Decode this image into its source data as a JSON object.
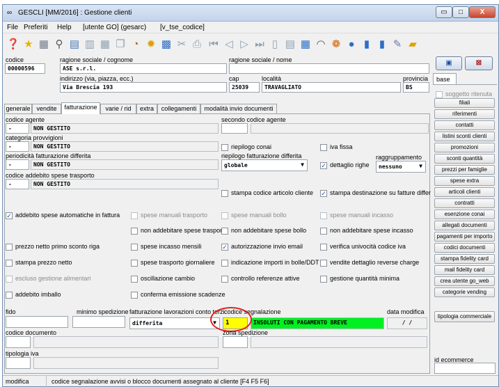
{
  "window": {
    "title": "GESCLI [MM/2016] : Gestione clienti",
    "minimize": "▭",
    "maximize": "□",
    "close": "X"
  },
  "menu": [
    "File",
    "Preferiti",
    "Help",
    "[utente GO] (gesarc)",
    "[v_tse_codice]"
  ],
  "header": {
    "codice_label": "codice",
    "codice": "00000596",
    "ragione_label": "ragione sociale / cognome",
    "ragione": "ASE s.r.l.",
    "nome_label": "ragione sociale / nome",
    "indirizzo_label": "indirizzo (via, piazza, ecc.)",
    "indirizzo": "Via Brescia 193",
    "cap_label": "cap",
    "cap": "25039",
    "localita_label": "località",
    "localita": "TRAVAGLIATO",
    "provincia_label": "provincia",
    "provincia": "BS",
    "base_tab": "base",
    "soggetto": "soggetto ritenuta"
  },
  "tabs": [
    "generale",
    "vendite",
    "fatturazione",
    "varie / rid",
    "extra",
    "collegamenti",
    "modalità invio documenti"
  ],
  "form": {
    "codice_agente_label": "codice agente",
    "codice_agente_code": "-",
    "codice_agente_value": "NON GESTITO",
    "secondo_agente_label": "secondo codice agente",
    "cat_prov_label": "categoria provvigioni",
    "cat_prov_code": "-",
    "cat_prov_value": "NON GESTITO",
    "riepilogo_conai": "riepilogo conai",
    "iva_fissa": "iva fissa",
    "period_label": "periodicità fatturazione differita",
    "period_code": "-",
    "period_value": "NON GESTITO",
    "riepilogo_fatt_label": "riepilogo fatturazione differita",
    "riepilogo_fatt_value": "globale",
    "dettaglio_righe": "dettaglio righe",
    "raggr_label": "raggruppamento",
    "raggr_value": "nessuno",
    "addebito_label": "codice addebito spese trasporto",
    "addebito_code": "-",
    "addebito_value": "NON GESTITO",
    "stampa_codice": "stampa codice articolo cliente",
    "stampa_dest": "stampa destinazione su fatture differ",
    "addebito_auto": "addebito spese automatiche in fattura",
    "spese_man_trasp": "spese manuali trasporto",
    "spese_man_bollo": "spese manuali bollo",
    "spese_man_incasso": "spese manuali incasso",
    "non_add_trasp": "non addebitare spese trasporto",
    "non_add_bollo": "non addebitare spese bollo",
    "non_add_incasso": "non addebitare spese incasso",
    "prezzo_netto_primo": "prezzo netto primo sconto riga",
    "spese_incasso_mens": "spese incasso mensili",
    "autorizz_email": "autorizzazione invio email",
    "verifica_iva": "verifica univocità codice iva",
    "stampa_prezzo": "stampa prezzo netto",
    "spese_trasp_giorn": "spese trasporto giornaliere",
    "indicazione_importi": "indicazione importi in bolle/DDT",
    "vendite_reverse": "vendite dettaglio reverse charge",
    "escluso_alim": "escluso gestione alimentari",
    "oscillazione": "oscillazione cambio",
    "controllo_ref": "controllo referenze attive",
    "gestione_qty": "gestione quantità minima",
    "addebito_imballo": "addebito imballo",
    "conferma_scad": "conferma emissione scadenze",
    "fido_label": "fido",
    "min_sped_label": "minimo spedizione",
    "fatt_lav_label": "fatturazione lavorazioni conto terzi",
    "fatt_lav_value": "differita",
    "cod_segn_label": "codice segnalazione",
    "cod_segn_code": "1",
    "cod_segn_value": "INSOLUTI CON PAGAMENTO BREVE",
    "data_mod_label": "data modifica",
    "data_mod_value": "/ /",
    "cod_doc_label": "codice documento",
    "zona_label": "zona spedizione",
    "tip_iva_label": "tipologia iva"
  },
  "side_buttons": [
    "filiali",
    "riferimenti",
    "contatti",
    "listini sconti clienti",
    "promozioni",
    "sconti quantità",
    "prezzi per famiglie",
    "spese extra",
    "articoli clienti",
    "contratti",
    "esenzione conai",
    "allegati documenti",
    "pagamenti per importo",
    "codici documenti",
    "stampa fidelity card",
    "mail fidelity card",
    "crea utente go_web",
    "categorie vending"
  ],
  "tipologia_btn": "tipologia commerciale",
  "id_ecommerce_label": "id ecommerce",
  "status": {
    "mode": "modifica",
    "message": "codice segnalazione avvisi o blocco documenti assegnato al cliente [F4 F5 F6]"
  }
}
